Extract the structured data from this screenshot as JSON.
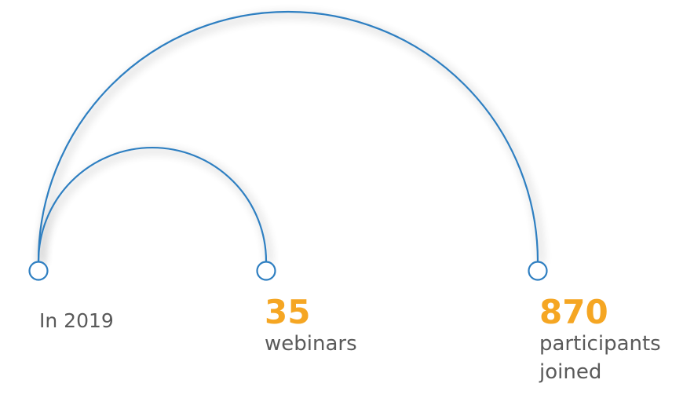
{
  "start": {
    "label": "In 2019"
  },
  "stats": {
    "webinars": {
      "number": "35",
      "text": "webinars"
    },
    "participants": {
      "number": "870",
      "text": "participants joined"
    }
  },
  "colors": {
    "arc": "#2f7fc1",
    "accent": "#f5a623",
    "text": "#5a5a5a",
    "node_fill": "#ffffff"
  }
}
